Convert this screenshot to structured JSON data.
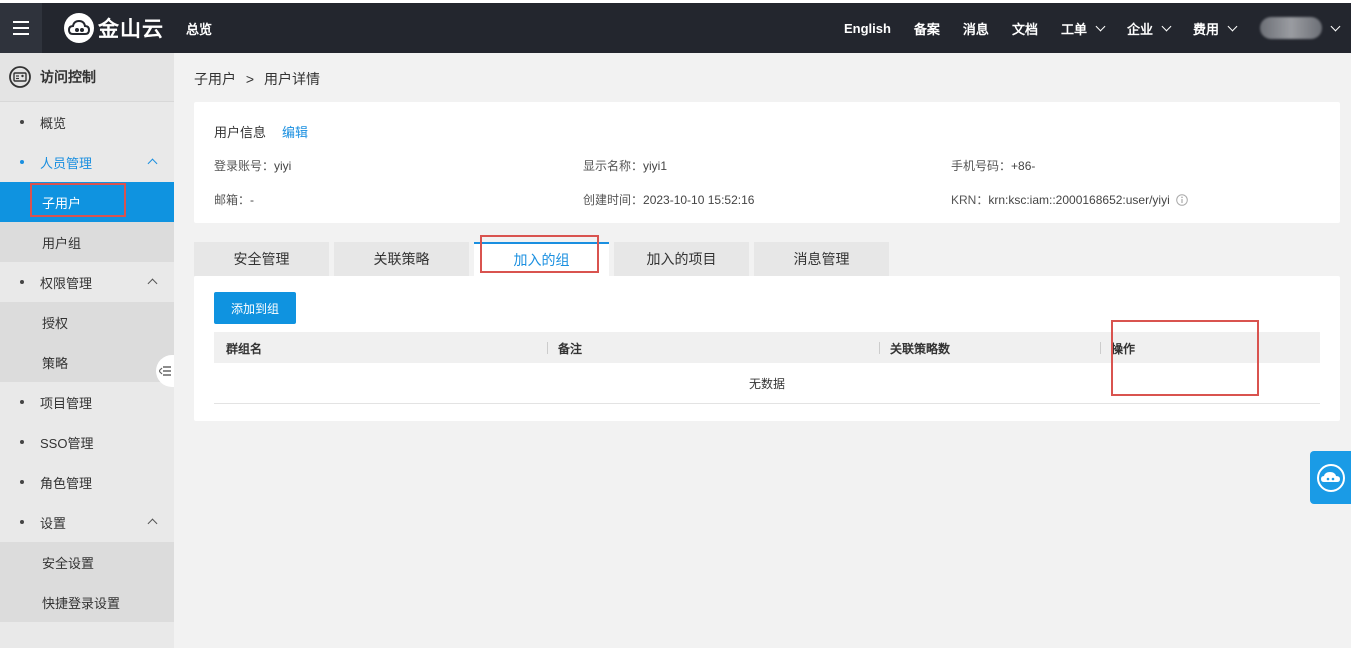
{
  "topbar": {
    "logo_text": "金山云",
    "overview": "总览",
    "links": [
      "English",
      "备案",
      "消息",
      "文档"
    ],
    "dropdowns": [
      "工单",
      "企业",
      "费用"
    ]
  },
  "sidebar": {
    "title": "访问控制",
    "items": {
      "overview": "概览",
      "personnel": "人员管理",
      "subuser": "子用户",
      "usergroup": "用户组",
      "permission": "权限管理",
      "authorize": "授权",
      "policy": "策略",
      "project": "项目管理",
      "sso": "SSO管理",
      "role": "角色管理",
      "settings": "设置",
      "security_settings": "安全设置",
      "quick_login": "快捷登录设置"
    }
  },
  "breadcrumb": {
    "parent": "子用户",
    "separator": ">",
    "current": "用户详情"
  },
  "user_info": {
    "heading": "用户信息",
    "edit": "编辑",
    "login_label": "登录账号：",
    "login_value": "yiyi",
    "display_label": "显示名称：",
    "display_value": "yiyi1",
    "phone_label": "手机号码：",
    "phone_value": "+86-",
    "email_label": "邮箱：",
    "email_value": "-",
    "created_label": "创建时间：",
    "created_value": "2023-10-10 15:52:16",
    "krn_label": "KRN：",
    "krn_value": "krn:ksc:iam::2000168652:user/yiyi"
  },
  "tabs": [
    "安全管理",
    "关联策略",
    "加入的组",
    "加入的项目",
    "消息管理"
  ],
  "active_tab": "加入的组",
  "group_panel": {
    "add_button": "添加到组",
    "columns": [
      "群组名",
      "备注",
      "关联策略数",
      "操作"
    ],
    "empty_text": "无数据"
  },
  "colors": {
    "accent": "#0f93e0",
    "topbar": "#23262e",
    "annotation": "#d9534f"
  }
}
